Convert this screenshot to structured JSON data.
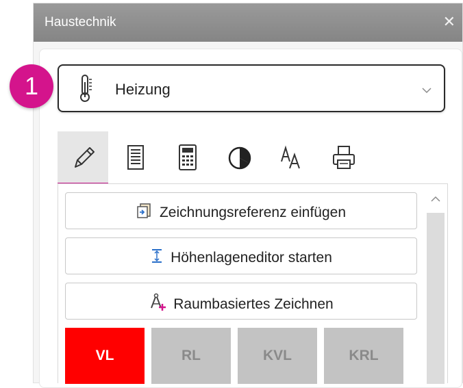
{
  "window": {
    "title": "Haustechnik",
    "close_label": "✕"
  },
  "annotation": {
    "number": "1"
  },
  "discipline_select": {
    "value": "Heizung",
    "icon": "thermometer-icon"
  },
  "tabs": [
    {
      "icon": "pencil-icon",
      "active": true
    },
    {
      "icon": "notebook-icon",
      "active": false
    },
    {
      "icon": "calculator-icon",
      "active": false
    },
    {
      "icon": "pie-chart-icon",
      "active": false
    },
    {
      "icon": "font-size-icon",
      "active": false
    },
    {
      "icon": "printer-icon",
      "active": false
    }
  ],
  "actions": [
    {
      "label": "Zeichnungsreferenz einfügen",
      "icon": "insert-reference-icon"
    },
    {
      "label": "Höhenlageneditor starten",
      "icon": "elevation-icon"
    },
    {
      "label": "Raumbasiertes Zeichnen",
      "icon": "room-draw-icon"
    }
  ],
  "pipe_types": [
    {
      "label": "VL",
      "active": true
    },
    {
      "label": "RL",
      "active": false
    },
    {
      "label": "KVL",
      "active": false
    },
    {
      "label": "KRL",
      "active": false
    }
  ],
  "colors": {
    "accent": "#c5158a",
    "badge": "#d4148c",
    "active_tile": "#ff0000",
    "inactive_tile": "#c3c3c3",
    "titlebar": "#8f8f8f"
  }
}
